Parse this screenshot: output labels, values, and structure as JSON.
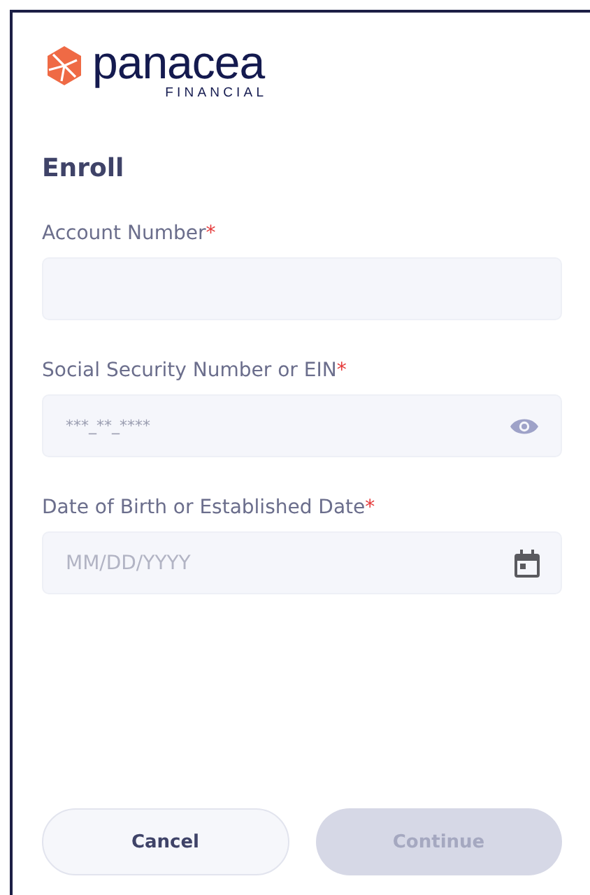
{
  "logo": {
    "name": "panacea",
    "tagline": "FINANCIAL"
  },
  "title": "Enroll",
  "fields": [
    {
      "label": "Account Number",
      "required_mark": "*",
      "kind": "text"
    },
    {
      "label": "Social Security Number or EIN",
      "required_mark": "*",
      "kind": "secret",
      "placeholder": "***_**_****"
    },
    {
      "label": "Date of Birth or Established Date",
      "required_mark": "*",
      "kind": "date",
      "placeholder": "MM/DD/YYYY"
    }
  ],
  "buttons": [
    {
      "label": "Cancel",
      "kind": "secondary",
      "disabled": false
    },
    {
      "label": "Continue",
      "kind": "primary",
      "disabled": true
    }
  ]
}
